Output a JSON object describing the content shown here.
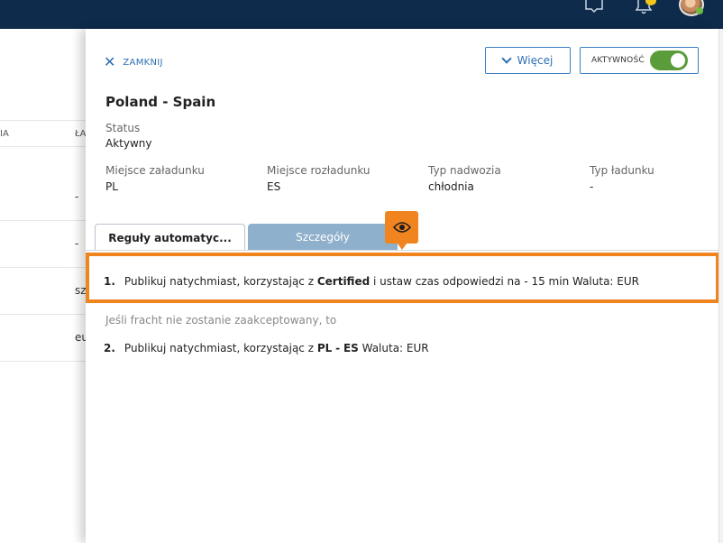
{
  "background_list": {
    "header": [
      "IA",
      "ŁA"
    ],
    "rows": [
      "-",
      "-",
      "sz",
      "eu"
    ]
  },
  "panel": {
    "close_label": "ZAMKNIJ",
    "more_label": "Więcej",
    "activity_label": "AKTYWNOŚĆ",
    "activity_on": true,
    "title": "Poland - Spain",
    "status_label": "Status",
    "status_value": "Aktywny",
    "fields": [
      {
        "label": "Miejsce załadunku",
        "value": "PL"
      },
      {
        "label": "Miejsce rozładunku",
        "value": "ES"
      },
      {
        "label": "Typ nadwozia",
        "value": "chłodnia"
      },
      {
        "label": "Typ ładunku",
        "value": "-"
      }
    ],
    "tabs": [
      {
        "label": "Reguły automatyc..."
      },
      {
        "label": "Szczegóły"
      }
    ],
    "rules": [
      {
        "num": "1.",
        "text_a": "Publikuj natychmiast, korzystając z",
        "bold_a": "Certified",
        "text_b": "i ustaw czas odpowiedzi na - 15 min Waluta: EUR"
      },
      {
        "num": "2.",
        "text_a": "Publikuj natychmiast, korzystając z",
        "bold_a": "PL",
        "sep": "-",
        "bold_b": "ES",
        "text_b": "Waluta: EUR"
      }
    ],
    "fallback_text": "Jeśli fracht nie zostanie zaakceptowany, to"
  },
  "colors": {
    "topbar": "#0e2b4c",
    "accent": "#2c6fb3",
    "highlight": "#f0841e",
    "toggle": "#5a9c3a",
    "tab_inactive": "#8fb0cc"
  }
}
